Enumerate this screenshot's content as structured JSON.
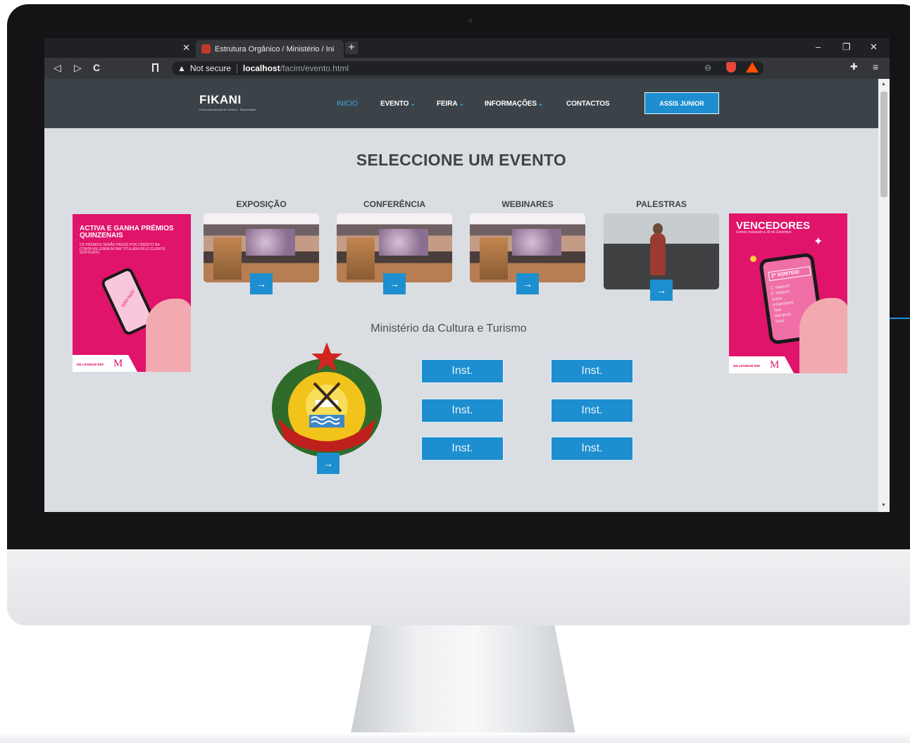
{
  "browser": {
    "tab_title": "Estrutura Orgânico / Ministério / Inicio",
    "tab_close": "✕",
    "new_tab": "+",
    "window_controls": [
      "–",
      "❐",
      "✕"
    ],
    "nav_icons": [
      "◁",
      "▷",
      "C"
    ],
    "bookmark_icon": "bookmark-icon",
    "security_label": "Not secure",
    "url_host": "localhost",
    "url_path": "/facim/evento.html",
    "zoom_icon": "⊖",
    "menu_icon": "≡"
  },
  "site": {
    "logo": "FIKANI",
    "logo_sub": "Feira Internacional de Turismo · Moçambique",
    "nav": [
      {
        "label": "INICIO",
        "active": true,
        "dropdown": false
      },
      {
        "label": "EVENTO",
        "active": false,
        "dropdown": true
      },
      {
        "label": "FEIRA",
        "active": false,
        "dropdown": true
      },
      {
        "label": "INFORMAÇÕES",
        "active": false,
        "dropdown": true
      },
      {
        "label": "CONTACTOS",
        "active": false,
        "dropdown": false
      }
    ],
    "user_button": "ASSIS JUNIOR"
  },
  "main": {
    "heading": "SELECCIONE UM EVENTO",
    "events": [
      {
        "label": "EXPOSIÇÃO"
      },
      {
        "label": "CONFERÊNCIA"
      },
      {
        "label": "WEBINARES"
      },
      {
        "label": "PALESTRAS"
      }
    ],
    "arrow": "→",
    "ministry_title": "Ministério da Cultura e Turismo",
    "inst_buttons": [
      "Inst.",
      "Inst.",
      "Inst.",
      "Inst.",
      "Inst.",
      "Inst."
    ]
  },
  "ads": {
    "left": {
      "title": "ACTIVA E GANHA PRÉMIOS QUINZENAIS",
      "subtitle": "OS PRÉMIOS SERÃO PAGOS POR CRÉDITO NA CONTA MILLENNIUM BIM TITULADA PELO CLIENTE SORTEADO.",
      "amount": "5000 MZN",
      "bank": "MILLENNIUM BIM",
      "mark": "M"
    },
    "right": {
      "title": "VENCEDORES",
      "subtitle": "Sorteio realizado a 30 de Setembro",
      "draw": "2º SORTEIO",
      "list": [
        "C. Maputo",
        "P. Maputo",
        "Gaza",
        "Inhambane",
        "Tete",
        "Nampula",
        "Total"
      ],
      "bank": "MILLENNIUM BIM",
      "mark": "M"
    }
  },
  "colors": {
    "accent": "#1d8fd0",
    "header_bg": "#3c4348",
    "page_bg": "#dadee2",
    "ad_pink": "#e0146a"
  }
}
